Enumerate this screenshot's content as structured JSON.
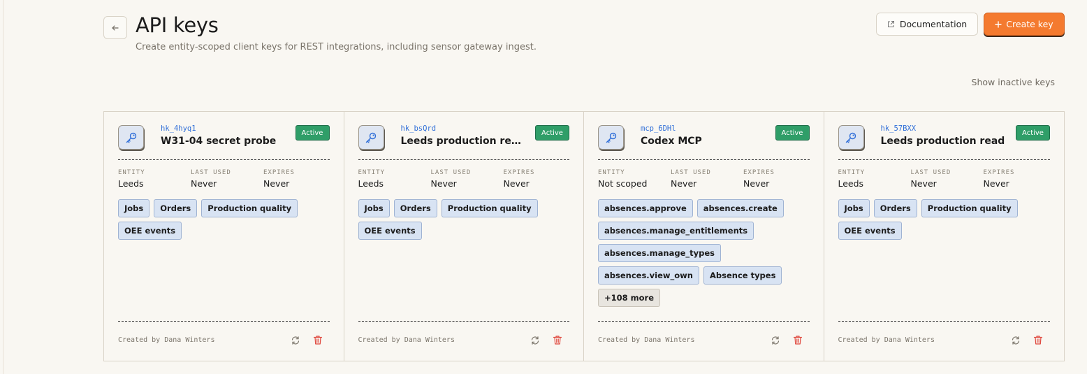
{
  "header": {
    "back_icon": "arrow-left-icon",
    "title": "API keys",
    "subtitle": "Create entity-scoped client keys for REST integrations, including sensor gateway ingest.",
    "documentation_label": "Documentation",
    "create_label": "Create key",
    "show_inactive_label": "Show inactive keys"
  },
  "meta_labels": {
    "entity": "ENTITY",
    "last_used": "LAST USED",
    "expires": "EXPIRES"
  },
  "colors": {
    "accent": "#f47a2f",
    "active": "#2f9e68",
    "prefix": "#2f6ed8",
    "delete": "#e0483e"
  },
  "cards": [
    {
      "prefix": "hk_4hyq1",
      "name": "W31-04 secret probe",
      "status": "Active",
      "entity": "Leeds",
      "last_used": "Never",
      "expires": "Never",
      "tags": [
        "Jobs",
        "Orders",
        "Production quality",
        "OEE events"
      ],
      "more": "",
      "created_by": "Created by Dana Winters"
    },
    {
      "prefix": "hk_bsQrd",
      "name": "Leeds production reporti…",
      "status": "Active",
      "entity": "Leeds",
      "last_used": "Never",
      "expires": "Never",
      "tags": [
        "Jobs",
        "Orders",
        "Production quality",
        "OEE events"
      ],
      "more": "",
      "created_by": "Created by Dana Winters"
    },
    {
      "prefix": "mcp_6DHl",
      "name": "Codex MCP",
      "status": "Active",
      "entity": "Not scoped",
      "last_used": "Never",
      "expires": "Never",
      "tags": [
        "absences.approve",
        "absences.create",
        "absences.manage_entitlements",
        "absences.manage_types",
        "absences.view_own",
        "Absence types"
      ],
      "more": "+108 more",
      "created_by": "Created by Dana Winters"
    },
    {
      "prefix": "hk_57BXX",
      "name": "Leeds production read",
      "status": "Active",
      "entity": "Leeds",
      "last_used": "Never",
      "expires": "Never",
      "tags": [
        "Jobs",
        "Orders",
        "Production quality",
        "OEE events"
      ],
      "more": "",
      "created_by": "Created by Dana Winters"
    }
  ]
}
